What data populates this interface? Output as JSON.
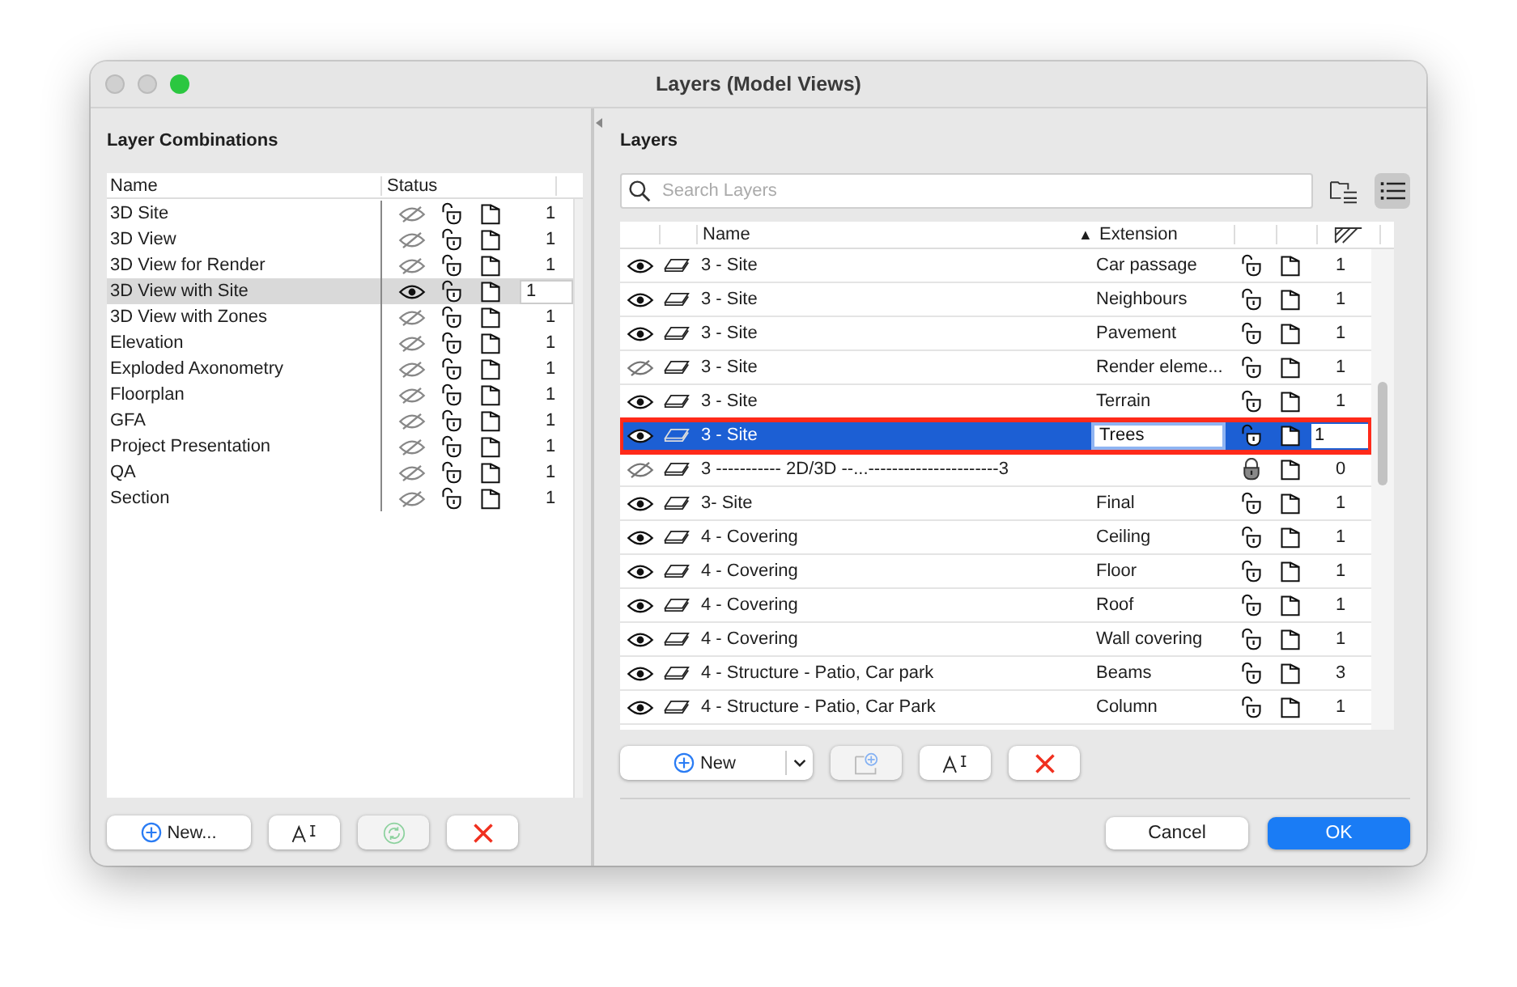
{
  "window": {
    "title": "Layers (Model Views)"
  },
  "combinations": {
    "heading": "Layer Combinations",
    "columns": [
      "Name",
      "Status"
    ],
    "rows": [
      {
        "name": "3D Site",
        "visible": false,
        "count": "1",
        "selected": false
      },
      {
        "name": "3D View",
        "visible": false,
        "count": "1",
        "selected": false
      },
      {
        "name": "3D View for Render",
        "visible": false,
        "count": "1",
        "selected": false
      },
      {
        "name": "3D View with Site",
        "visible": true,
        "count": "1",
        "selected": true
      },
      {
        "name": "3D View with Zones",
        "visible": false,
        "count": "1",
        "selected": false
      },
      {
        "name": "Elevation",
        "visible": false,
        "count": "1",
        "selected": false
      },
      {
        "name": "Exploded Axonometry",
        "visible": false,
        "count": "1",
        "selected": false
      },
      {
        "name": "Floorplan",
        "visible": false,
        "count": "1",
        "selected": false
      },
      {
        "name": "GFA",
        "visible": false,
        "count": "1",
        "selected": false
      },
      {
        "name": "Project Presentation",
        "visible": false,
        "count": "1",
        "selected": false
      },
      {
        "name": "QA",
        "visible": false,
        "count": "1",
        "selected": false
      },
      {
        "name": "Section",
        "visible": false,
        "count": "1",
        "selected": false
      }
    ]
  },
  "combination_buttons": [
    {
      "kind": "new",
      "label": "New...",
      "disabled": false
    },
    {
      "kind": "rename",
      "disabled": false
    },
    {
      "kind": "update",
      "disabled": true
    },
    {
      "kind": "delete",
      "disabled": false
    }
  ],
  "layers": {
    "heading": "Layers",
    "search": {
      "placeholder": "Search Layers"
    },
    "view_modes": [
      {
        "kind": "folders",
        "selected": false
      },
      {
        "kind": "list",
        "selected": true
      }
    ],
    "columns": {
      "name": "Name",
      "sort_mark": "▲",
      "extension": "Extension"
    },
    "rows": [
      {
        "visible": true,
        "locked": false,
        "name": "3 - Site",
        "extension": "Car passage",
        "count": "1",
        "selected": false
      },
      {
        "visible": true,
        "locked": false,
        "name": "3 - Site",
        "extension": "Neighbours",
        "count": "1",
        "selected": false
      },
      {
        "visible": true,
        "locked": false,
        "name": "3 - Site",
        "extension": "Pavement",
        "count": "1",
        "selected": false
      },
      {
        "visible": false,
        "locked": false,
        "name": "3 - Site",
        "extension": "Render eleme...",
        "count": "1",
        "selected": false
      },
      {
        "visible": true,
        "locked": false,
        "name": "3 - Site",
        "extension": "Terrain",
        "count": "1",
        "selected": false
      },
      {
        "visible": true,
        "locked": false,
        "name": "3 - Site",
        "extension": "Trees",
        "count": "1",
        "selected": true
      },
      {
        "visible": false,
        "locked": true,
        "name": "3 ----------- 2D/3D --...----------------------3",
        "count": "0",
        "selected": false
      },
      {
        "visible": true,
        "locked": false,
        "name": "3- Site",
        "extension": "Final",
        "count": "1",
        "selected": false
      },
      {
        "visible": true,
        "locked": false,
        "name": "4 - Covering",
        "extension": "Ceiling",
        "count": "1",
        "selected": false
      },
      {
        "visible": true,
        "locked": false,
        "name": "4 - Covering",
        "extension": "Floor",
        "count": "1",
        "selected": false
      },
      {
        "visible": true,
        "locked": false,
        "name": "4 - Covering",
        "extension": "Roof",
        "count": "1",
        "selected": false
      },
      {
        "visible": true,
        "locked": false,
        "name": "4 - Covering",
        "extension": "Wall covering",
        "count": "1",
        "selected": false
      },
      {
        "visible": true,
        "locked": false,
        "name": "4 - Structure - Patio, Car park",
        "extension": "Beams",
        "count": "3",
        "selected": false
      },
      {
        "visible": true,
        "locked": false,
        "name": "4 - Structure - Patio, Car Park",
        "extension": "Column",
        "count": "1",
        "selected": false
      }
    ]
  },
  "layer_buttons": [
    {
      "kind": "new",
      "label": "New",
      "disabled": false
    },
    {
      "kind": "new-folder",
      "disabled": true
    },
    {
      "kind": "rename",
      "disabled": false
    },
    {
      "kind": "delete",
      "disabled": false
    }
  ],
  "dialog_buttons": [
    {
      "label": "Cancel",
      "default": false
    },
    {
      "label": "OK",
      "default": true
    }
  ]
}
